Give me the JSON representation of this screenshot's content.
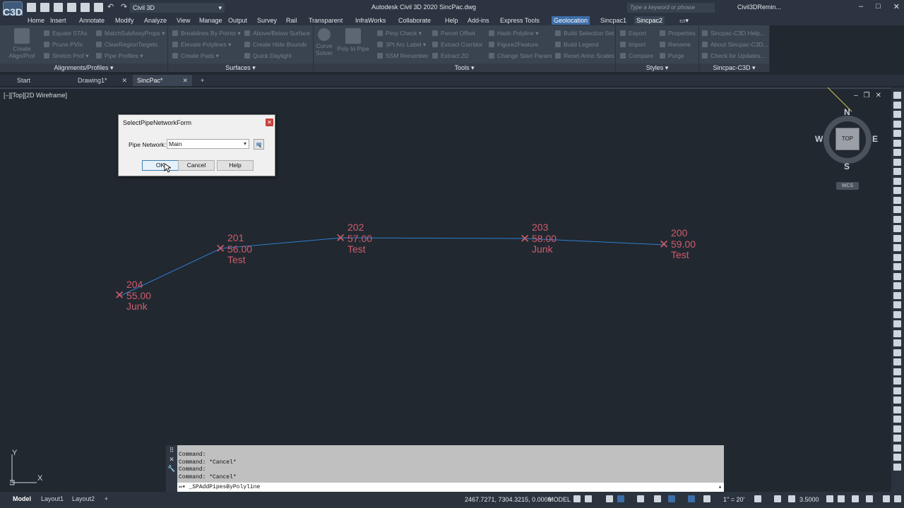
{
  "app": {
    "title": "Autodesk Civil 3D 2020  SincPac.dwg",
    "logo": "C3D",
    "workspace": "Civil 3D",
    "search_placeholder": "Type a keyword or phrase",
    "user": "Civil3DRemin...",
    "window_buttons": [
      "–",
      "□",
      "✕"
    ]
  },
  "menu": [
    "Home",
    "Insert",
    "Annotate",
    "Modify",
    "Analyze",
    "View",
    "Manage",
    "Output",
    "Survey",
    "Rail",
    "Transparent",
    "InfraWorks",
    "Collaborate",
    "Help",
    "Add-ins",
    "Express Tools",
    "Geolocation",
    "Sincpac1",
    "Sincpac2"
  ],
  "menu_active": "Geolocation",
  "menu_selected": "Sincpac2",
  "ribbon": {
    "panels": [
      {
        "label": "Alignments/Profiles ▾",
        "big": [
          "Create",
          "Align/Prof"
        ],
        "items": [
          "Equate STAs",
          "MatchSubAssyProps ▾",
          "Prune PVIs",
          "ClearRegionTargets",
          "Stretch Prof ▾",
          "Pipe Profiles ▾"
        ]
      },
      {
        "label": "Surfaces ▾",
        "items": [
          "Breaklines By Points ▾",
          "Above/Below Surface",
          "Elevate Polylines ▾",
          "Create Hide Bounds",
          "Create Pads ▾",
          "Quick Daylight"
        ]
      },
      {
        "label": "Tools ▾",
        "big1": [
          "Curve",
          "Solver"
        ],
        "big2": [
          "Poly to Pipe"
        ],
        "items": [
          "Perp Check ▾",
          "Parcel Offset",
          "Hash Polyline ▾",
          "Build Selection Set",
          "3Pt Arc Label ▾",
          "Extract Corridor",
          "Figure2Feature",
          "Build Legend",
          "SSM Renumber",
          "Extract 2D",
          "Change Start Param",
          "Reset Anno Scales"
        ]
      },
      {
        "label": "Styles ▾",
        "items": [
          "Export",
          "Properties",
          "Import",
          "Rename",
          "Compare",
          "Purge"
        ]
      },
      {
        "label": "Sincpac-C3D ▾",
        "items": [
          "Sincpac-C3D Help...",
          "About Sincpac-C3D...",
          "Check for Updates..."
        ]
      }
    ]
  },
  "doctabs": [
    {
      "label": "Start"
    },
    {
      "label": "Drawing1*"
    },
    {
      "label": "SincPac*"
    }
  ],
  "viewport": {
    "label": "[–][Top][2D Wireframe]",
    "controls": [
      "–",
      "❐",
      "✕"
    ],
    "compass": {
      "n": "N",
      "s": "S",
      "e": "E",
      "w": "W",
      "top": "TOP",
      "wcs": "WCS"
    }
  },
  "dialog": {
    "title": "SelectPipeNetworkForm",
    "field_label": "Pipe Network:",
    "selected": "Main",
    "buttons": {
      "ok": "OK",
      "cancel": "Cancel",
      "help": "Help"
    }
  },
  "structures": [
    {
      "name": "204",
      "elev": "55.00",
      "desc": "Junk"
    },
    {
      "name": "201",
      "elev": "56.00",
      "desc": "Test"
    },
    {
      "name": "202",
      "elev": "57.00",
      "desc": "Test"
    },
    {
      "name": "203",
      "elev": "58.00",
      "desc": "Junk"
    },
    {
      "name": "200",
      "elev": "59.00",
      "desc": "Test"
    }
  ],
  "command": {
    "history": [
      "Command:",
      "Command: *Cancel*",
      "Command:",
      "Command: *Cancel*"
    ],
    "input": "_SPAddPipesByPolyline"
  },
  "ucs": {
    "x": "X",
    "y": "Y"
  },
  "status": {
    "tabs": [
      "Model",
      "Layout1",
      "Layout2"
    ],
    "add_tab": "+",
    "coords": "2467.7271, 7304.3215, 0.0000",
    "mode": "MODEL",
    "scale": "1\" = 20'",
    "value": "3.5000"
  },
  "colors": {
    "structure": "#d05c6a",
    "pipe": "#2f7fd0",
    "accent": "#3d6ea8"
  }
}
